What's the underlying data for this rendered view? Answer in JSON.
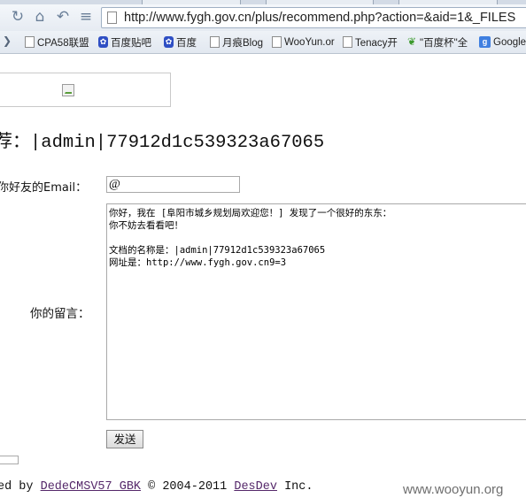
{
  "browser": {
    "url": "http://www.fygh.gov.cn/plus/recommend.php?action=&aid=1&_FILES",
    "bookmarks": [
      {
        "label": "CPA58联盟",
        "icon": "page-icon"
      },
      {
        "label": "百度贴吧",
        "icon": "baidu-paw-icon"
      },
      {
        "label": "百度",
        "icon": "baidu-paw-icon"
      },
      {
        "label": "月痕Blog",
        "icon": "page-icon"
      },
      {
        "label": "WooYun.or",
        "icon": "page-icon"
      },
      {
        "label": "Tenacy开",
        "icon": "page-icon"
      },
      {
        "label": "\"百度杯\"全",
        "icon": "leaf-icon"
      },
      {
        "label": "Google",
        "icon": "google-icon"
      }
    ]
  },
  "page": {
    "title_prefix": "荐：",
    "title_value": "|admin|77912d1c539323a67065",
    "email_label": "你好友的Email：",
    "email_value": "@",
    "message_label": "你的留言：",
    "message_value": "你好，我在 [阜阳市城乡规划局欢迎您！] 发现了一个很好的东东：\n你不妨去看看吧！\n\n文档的名称是：|admin|77912d1c539323a67065\n网址是：http://www.fygh.gov.cn9=3",
    "send_label": "发送"
  },
  "footer": {
    "prefix": "ed by ",
    "dedecms_link": "DedeCMSV57_GBK",
    "middle": " © 2004-2011 ",
    "desdev_link": "DesDev",
    "suffix": " Inc."
  },
  "watermark": "www.wooyun.org"
}
